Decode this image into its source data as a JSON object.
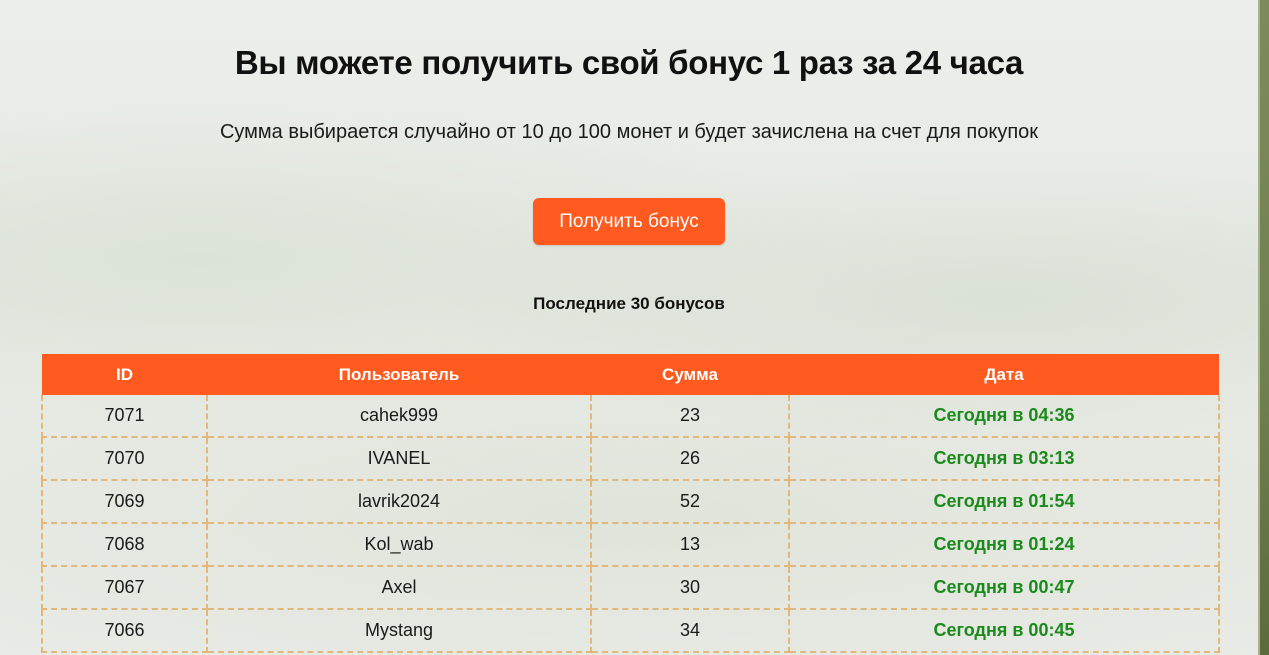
{
  "header": {
    "title": "Вы можете получить свой бонус 1 раз за 24 часа",
    "subtitle": "Сумма выбирается случайно от 10 до 100 монет и будет зачислена на счет для покупок"
  },
  "bonus_button": {
    "label": "Получить бонус",
    "color": "#ff5a1f"
  },
  "last_bonuses": {
    "title": "Последние 30 бонусов",
    "columns": [
      "ID",
      "Пользователь",
      "Сумма",
      "Дата"
    ],
    "rows": [
      {
        "id": "7071",
        "user": "cahek999",
        "sum": "23",
        "date": "Сегодня в 04:36"
      },
      {
        "id": "7070",
        "user": "IVANEL",
        "sum": "26",
        "date": "Сегодня в 03:13"
      },
      {
        "id": "7069",
        "user": "lavrik2024",
        "sum": "52",
        "date": "Сегодня в 01:54"
      },
      {
        "id": "7068",
        "user": "Kol_wab",
        "sum": "13",
        "date": "Сегодня в 01:24"
      },
      {
        "id": "7067",
        "user": "Axel",
        "sum": "30",
        "date": "Сегодня в 00:47"
      },
      {
        "id": "7066",
        "user": "Mystang",
        "sum": "34",
        "date": "Сегодня в 00:45"
      }
    ]
  },
  "colors": {
    "accent": "#ff5a1f",
    "date_text": "#1a8a1a",
    "cell_border": "#e2b779"
  }
}
